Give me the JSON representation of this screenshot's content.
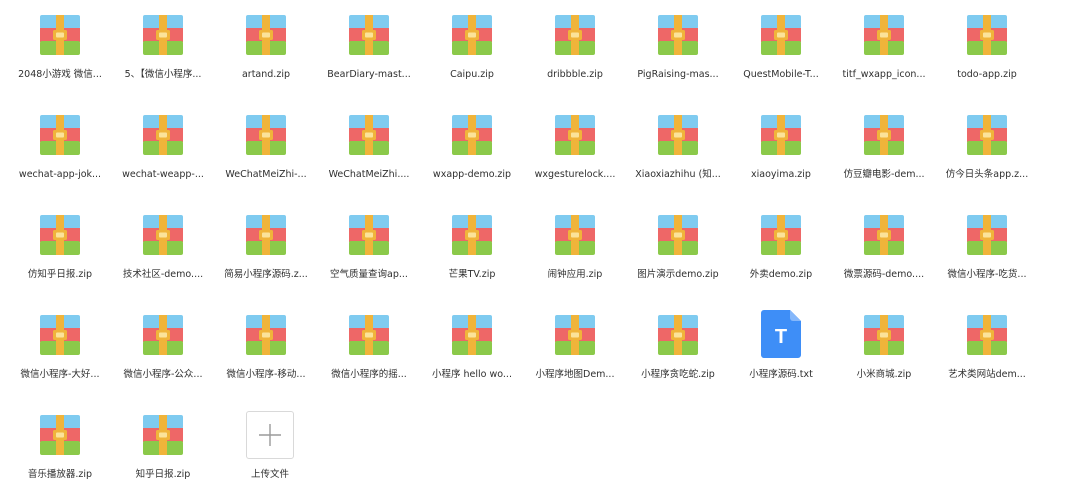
{
  "files": [
    {
      "name": "2048小游戏 微信...",
      "type": "zip"
    },
    {
      "name": "5、【微信小程序...",
      "type": "zip"
    },
    {
      "name": "artand.zip",
      "type": "zip"
    },
    {
      "name": "BearDiary-mast...",
      "type": "zip"
    },
    {
      "name": "Caipu.zip",
      "type": "zip"
    },
    {
      "name": "dribbble.zip",
      "type": "zip"
    },
    {
      "name": "PigRaising-mas...",
      "type": "zip"
    },
    {
      "name": "QuestMobile-T...",
      "type": "zip"
    },
    {
      "name": "titf_wxapp_icon...",
      "type": "zip"
    },
    {
      "name": "todo-app.zip",
      "type": "zip"
    },
    {
      "name": "wechat-app-jok...",
      "type": "zip"
    },
    {
      "name": "wechat-weapp-...",
      "type": "zip"
    },
    {
      "name": "WeChatMeiZhi-...",
      "type": "zip"
    },
    {
      "name": "WeChatMeiZhi....",
      "type": "zip"
    },
    {
      "name": "wxapp-demo.zip",
      "type": "zip"
    },
    {
      "name": "wxgesturelock....",
      "type": "zip"
    },
    {
      "name": "Xiaoxiazhihu (知...",
      "type": "zip"
    },
    {
      "name": "xiaoyima.zip",
      "type": "zip"
    },
    {
      "name": "仿豆瓣电影-dem...",
      "type": "zip"
    },
    {
      "name": "仿今日头条app.z...",
      "type": "zip"
    },
    {
      "name": "仿知乎日报.zip",
      "type": "zip"
    },
    {
      "name": "技术社区-demo....",
      "type": "zip"
    },
    {
      "name": "简易小程序源码.z...",
      "type": "zip"
    },
    {
      "name": "空气质量查询ap...",
      "type": "zip"
    },
    {
      "name": "芒果TV.zip",
      "type": "zip"
    },
    {
      "name": "闹钟应用.zip",
      "type": "zip"
    },
    {
      "name": "图片演示demo.zip",
      "type": "zip"
    },
    {
      "name": "外卖demo.zip",
      "type": "zip"
    },
    {
      "name": "微票源码-demo....",
      "type": "zip"
    },
    {
      "name": "微信小程序-吃货...",
      "type": "zip"
    },
    {
      "name": "微信小程序-大好...",
      "type": "zip"
    },
    {
      "name": "微信小程序-公众...",
      "type": "zip"
    },
    {
      "name": "微信小程序-移动...",
      "type": "zip"
    },
    {
      "name": "微信小程序的摇...",
      "type": "zip"
    },
    {
      "name": "小程序 hello wo...",
      "type": "zip"
    },
    {
      "name": "小程序地图Dem...",
      "type": "zip"
    },
    {
      "name": "小程序贪吃蛇.zip",
      "type": "zip"
    },
    {
      "name": "小程序源码.txt",
      "type": "txt",
      "icon_letter": "T"
    },
    {
      "name": "小米商城.zip",
      "type": "zip"
    },
    {
      "name": "艺术类网站dem...",
      "type": "zip"
    },
    {
      "name": "音乐播放器.zip",
      "type": "zip"
    },
    {
      "name": "知乎日报.zip",
      "type": "zip"
    }
  ],
  "upload": {
    "label": "上传文件",
    "icon": "plus-icon"
  },
  "colors": {
    "archive_top": "#7fcbf0",
    "archive_red": "#ee6767",
    "archive_green": "#8bc94a",
    "archive_strap": "#f0b43a",
    "archive_buckle": "#fbe39a",
    "txt_blue": "#3e8ef7"
  }
}
